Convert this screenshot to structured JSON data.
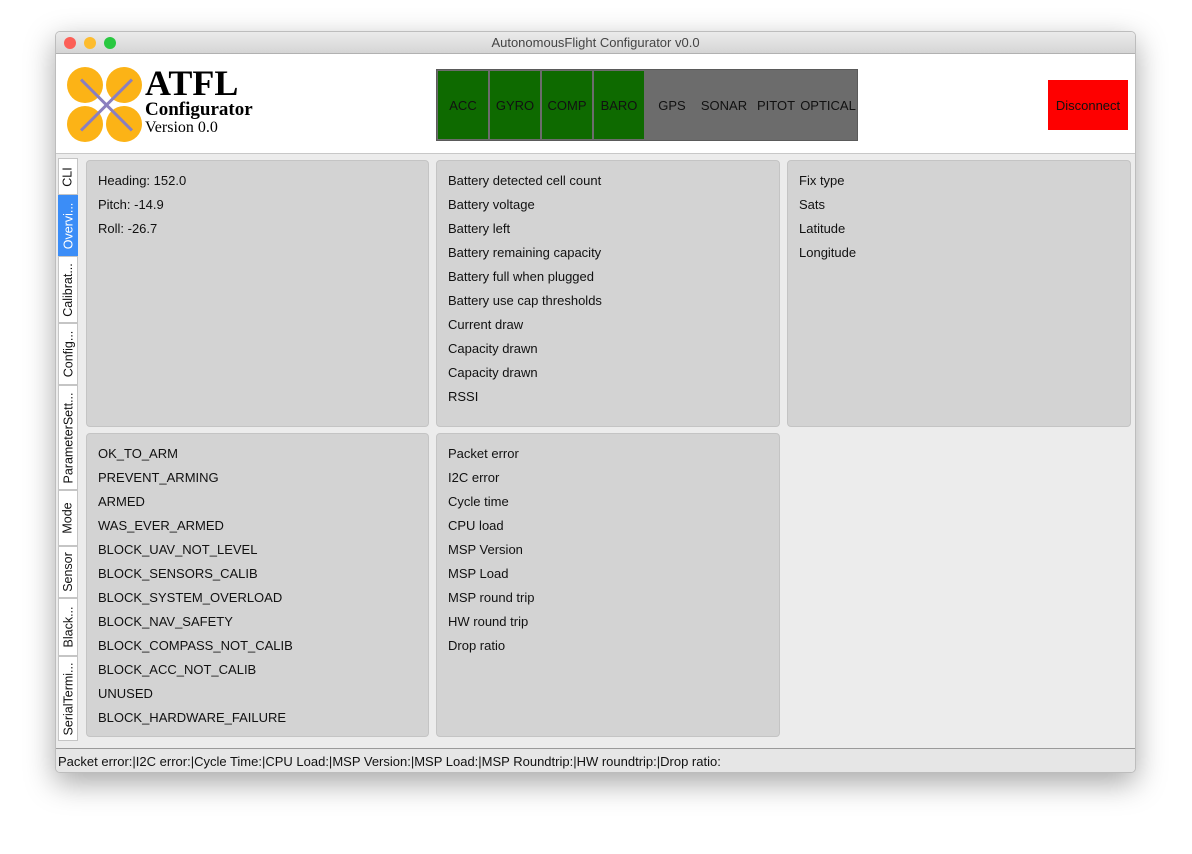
{
  "window": {
    "title": "AutonomousFlight Configurator v0.0"
  },
  "brand": {
    "title": "ATFL",
    "subtitle": "Configurator",
    "version": "Version 0.0"
  },
  "sensors": [
    {
      "label": "ACC",
      "detected": true
    },
    {
      "label": "GYRO",
      "detected": true
    },
    {
      "label": "COMP",
      "detected": true
    },
    {
      "label": "BARO",
      "detected": true
    },
    {
      "label": "GPS",
      "detected": false
    },
    {
      "label": "SONAR",
      "detected": false
    },
    {
      "label": "PITOT",
      "detected": false
    },
    {
      "label": "OPTICAL",
      "detected": false
    }
  ],
  "colors": {
    "sensor_on": "#0e6a00",
    "sensor_off": "#6c6c6c",
    "disconnect": "#fe0000",
    "active_tab": "#3b8df7"
  },
  "disconnect_label": "Disconnect",
  "tabs": [
    "CLI",
    "Overvi...",
    "Calibrat...",
    "Config...",
    "ParameterSett...",
    "Mode",
    "Sensor",
    "Black...",
    "SerialTermi..."
  ],
  "active_tab": 1,
  "attitude": [
    "Heading: 152.0",
    "Pitch: -14.9",
    "Roll: -26.7"
  ],
  "battery": [
    "Battery detected cell count",
    "Battery voltage",
    "Battery left",
    "Battery remaining capacity",
    "Battery full when plugged",
    "Battery use cap thresholds",
    "Current draw",
    "Capacity drawn",
    "Capacity drawn",
    "RSSI"
  ],
  "gps": [
    "Fix type",
    "Sats",
    "Latitude",
    "Longitude"
  ],
  "arming_flags": [
    "OK_TO_ARM",
    "PREVENT_ARMING",
    "ARMED",
    "WAS_EVER_ARMED",
    "BLOCK_UAV_NOT_LEVEL",
    "BLOCK_SENSORS_CALIB",
    "BLOCK_SYSTEM_OVERLOAD",
    "BLOCK_NAV_SAFETY",
    "BLOCK_COMPASS_NOT_CALIB",
    "BLOCK_ACC_NOT_CALIB",
    "UNUSED",
    "BLOCK_HARDWARE_FAILURE"
  ],
  "system": [
    "Packet error",
    "I2C error",
    "Cycle time",
    "CPU load",
    "MSP Version",
    "MSP Load",
    "MSP round trip",
    "HW round trip",
    "Drop ratio"
  ],
  "status_bar": "Packet error:|I2C error:|Cycle Time:|CPU Load:|MSP Version:|MSP Load:|MSP Roundtrip:|HW roundtrip:|Drop ratio:"
}
